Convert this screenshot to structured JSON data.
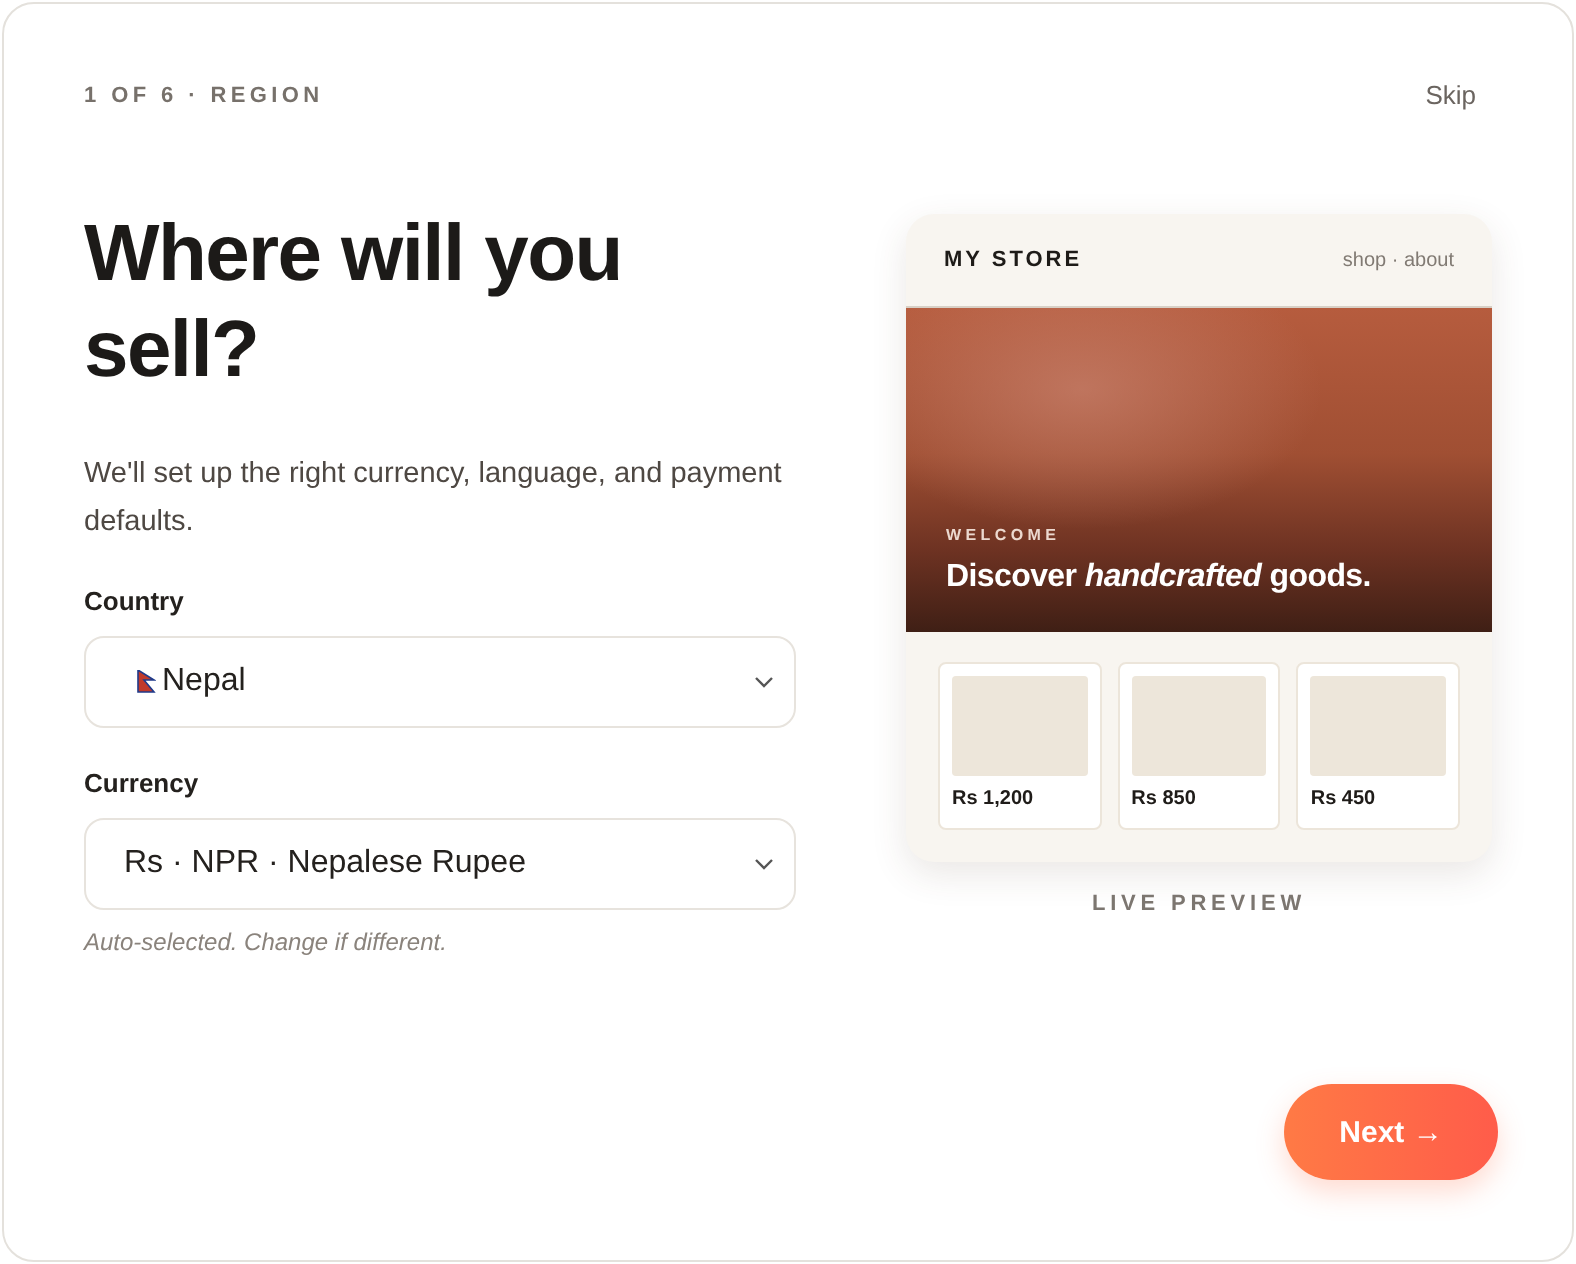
{
  "step_label": "1 OF 6 · REGION",
  "skip": "Skip",
  "heading": "Where will you sell?",
  "subtitle": "We'll set up the right currency, language, and payment defaults.",
  "fields": [
    {
      "label": "Country",
      "value": "Nepal",
      "kind": "flag"
    },
    {
      "label": "Currency",
      "value": "Rs · NPR · Nepalese Rupee",
      "kind": "plain",
      "hint": "Auto-selected. Change if different."
    }
  ],
  "preview": {
    "store_name": "MY STORE",
    "nav": "shop · about",
    "eyebrow": "WELCOME",
    "headline": "Discover *handcrafted* goods.",
    "products": [
      {
        "price": "Rs 1,200"
      },
      {
        "price": "Rs 850"
      },
      {
        "price": "Rs 450"
      }
    ],
    "caption": "LIVE PREVIEW"
  },
  "next_button": "Next →"
}
